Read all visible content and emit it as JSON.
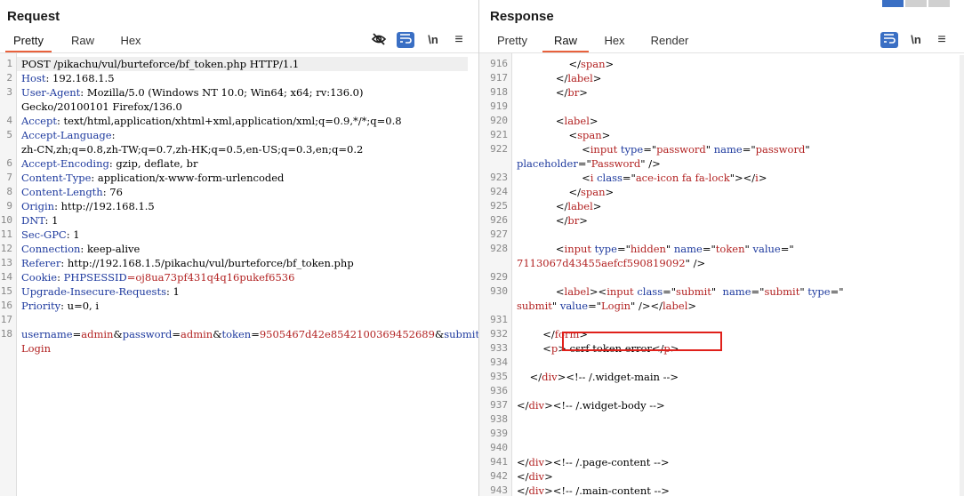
{
  "request": {
    "title": "Request",
    "tabs": [
      "Pretty",
      "Raw",
      "Hex"
    ],
    "active_tab": "Pretty",
    "toolbar": [
      "eye-slash-icon",
      "wrap-icon",
      "\\n",
      "menu-icon"
    ],
    "lines": [
      {
        "n": "1",
        "parts": [
          {
            "t": "POST /pikachu/vul/burteforce/bf_token.php HTTP/1.1",
            "c": ""
          }
        ]
      },
      {
        "n": "2",
        "parts": [
          {
            "t": "Host",
            "c": "hdr"
          },
          {
            "t": ": 192.168.1.5",
            "c": ""
          }
        ]
      },
      {
        "n": "3",
        "parts": [
          {
            "t": "User-Agent",
            "c": "hdr"
          },
          {
            "t": ": Mozilla/5.0 (Windows NT 10.0; Win64; x64; rv:136.0)",
            "c": ""
          }
        ]
      },
      {
        "n": "",
        "parts": [
          {
            "t": "Gecko/20100101 Firefox/136.0",
            "c": ""
          }
        ]
      },
      {
        "n": "4",
        "parts": [
          {
            "t": "Accept",
            "c": "hdr"
          },
          {
            "t": ": text/html,application/xhtml+xml,application/xml;q=0.9,*/*;q=0.8",
            "c": ""
          }
        ]
      },
      {
        "n": "5",
        "parts": [
          {
            "t": "Accept-Language",
            "c": "hdr"
          },
          {
            "t": ":",
            "c": ""
          }
        ]
      },
      {
        "n": "",
        "parts": [
          {
            "t": "zh-CN,zh;q=0.8,zh-TW;q=0.7,zh-HK;q=0.5,en-US;q=0.3,en;q=0.2",
            "c": ""
          }
        ]
      },
      {
        "n": "6",
        "parts": [
          {
            "t": "Accept-Encoding",
            "c": "hdr"
          },
          {
            "t": ": gzip, deflate, br",
            "c": ""
          }
        ]
      },
      {
        "n": "7",
        "parts": [
          {
            "t": "Content-Type",
            "c": "hdr"
          },
          {
            "t": ": application/x-www-form-urlencoded",
            "c": ""
          }
        ]
      },
      {
        "n": "8",
        "parts": [
          {
            "t": "Content-Length",
            "c": "hdr"
          },
          {
            "t": ": 76",
            "c": ""
          }
        ]
      },
      {
        "n": "9",
        "parts": [
          {
            "t": "Origin",
            "c": "hdr"
          },
          {
            "t": ": http://192.168.1.5",
            "c": ""
          }
        ]
      },
      {
        "n": "10",
        "parts": [
          {
            "t": "DNT",
            "c": "hdr"
          },
          {
            "t": ": 1",
            "c": ""
          }
        ]
      },
      {
        "n": "11",
        "parts": [
          {
            "t": "Sec-GPC",
            "c": "hdr"
          },
          {
            "t": ": 1",
            "c": ""
          }
        ]
      },
      {
        "n": "12",
        "parts": [
          {
            "t": "Connection",
            "c": "hdr"
          },
          {
            "t": ": keep-alive",
            "c": ""
          }
        ]
      },
      {
        "n": "13",
        "parts": [
          {
            "t": "Referer",
            "c": "hdr"
          },
          {
            "t": ": http://192.168.1.5/pikachu/vul/burteforce/bf_token.php",
            "c": ""
          }
        ]
      },
      {
        "n": "14",
        "parts": [
          {
            "t": "Cookie",
            "c": "hdr"
          },
          {
            "t": ": ",
            "c": ""
          },
          {
            "t": "PHPSESSID",
            "c": "hdr"
          },
          {
            "t": "=oj8ua73pf431q4q16pukef6536",
            "c": "red"
          }
        ]
      },
      {
        "n": "15",
        "parts": [
          {
            "t": "Upgrade-Insecure-Requests",
            "c": "hdr"
          },
          {
            "t": ": 1",
            "c": ""
          }
        ]
      },
      {
        "n": "16",
        "parts": [
          {
            "t": "Priority",
            "c": "hdr"
          },
          {
            "t": ": u=0, i",
            "c": ""
          }
        ]
      },
      {
        "n": "17",
        "parts": []
      },
      {
        "n": "18",
        "parts": [
          {
            "t": "username",
            "c": "hdr"
          },
          {
            "t": "=",
            "c": ""
          },
          {
            "t": "admin",
            "c": "red"
          },
          {
            "t": "&",
            "c": ""
          },
          {
            "t": "password",
            "c": "hdr"
          },
          {
            "t": "=",
            "c": ""
          },
          {
            "t": "admin",
            "c": "red"
          },
          {
            "t": "&",
            "c": ""
          },
          {
            "t": "token",
            "c": "hdr"
          },
          {
            "t": "=",
            "c": ""
          },
          {
            "t": "9505467d42e8542100369452689",
            "c": "red"
          },
          {
            "t": "&",
            "c": ""
          },
          {
            "t": "submit",
            "c": "hdr"
          },
          {
            "t": "=",
            "c": ""
          }
        ]
      },
      {
        "n": "",
        "parts": [
          {
            "t": "Login",
            "c": "red"
          }
        ]
      }
    ]
  },
  "response": {
    "title": "Response",
    "tabs": [
      "Pretty",
      "Raw",
      "Hex",
      "Render"
    ],
    "active_tab": "Raw",
    "toolbar": [
      "wrap-icon",
      "\\n",
      "menu-icon"
    ],
    "lines": [
      {
        "n": "916",
        "parts": [
          {
            "t": "                </",
            "c": ""
          },
          {
            "t": "span",
            "c": "tag"
          },
          {
            "t": ">",
            "c": ""
          }
        ]
      },
      {
        "n": "917",
        "parts": [
          {
            "t": "            </",
            "c": ""
          },
          {
            "t": "label",
            "c": "tag"
          },
          {
            "t": ">",
            "c": ""
          }
        ]
      },
      {
        "n": "918",
        "parts": [
          {
            "t": "            </",
            "c": ""
          },
          {
            "t": "br",
            "c": "tag"
          },
          {
            "t": ">",
            "c": ""
          }
        ]
      },
      {
        "n": "919",
        "parts": []
      },
      {
        "n": "920",
        "parts": [
          {
            "t": "            <",
            "c": ""
          },
          {
            "t": "label",
            "c": "tag"
          },
          {
            "t": ">",
            "c": ""
          }
        ]
      },
      {
        "n": "921",
        "parts": [
          {
            "t": "                <",
            "c": ""
          },
          {
            "t": "span",
            "c": "tag"
          },
          {
            "t": ">",
            "c": ""
          }
        ]
      },
      {
        "n": "922",
        "parts": [
          {
            "t": "                    <",
            "c": ""
          },
          {
            "t": "input",
            "c": "tag"
          },
          {
            "t": " ",
            "c": ""
          },
          {
            "t": "type",
            "c": "attr"
          },
          {
            "t": "=\"",
            "c": ""
          },
          {
            "t": "password",
            "c": "val"
          },
          {
            "t": "\" ",
            "c": ""
          },
          {
            "t": "name",
            "c": "attr"
          },
          {
            "t": "=\"",
            "c": ""
          },
          {
            "t": "password",
            "c": "val"
          },
          {
            "t": "\"",
            "c": ""
          }
        ]
      },
      {
        "n": "",
        "parts": [
          {
            "t": "placeholder",
            "c": "attr"
          },
          {
            "t": "=\"",
            "c": ""
          },
          {
            "t": "Password",
            "c": "val"
          },
          {
            "t": "\" />",
            "c": ""
          }
        ]
      },
      {
        "n": "923",
        "parts": [
          {
            "t": "                    <",
            "c": ""
          },
          {
            "t": "i",
            "c": "tag"
          },
          {
            "t": " ",
            "c": ""
          },
          {
            "t": "class",
            "c": "attr"
          },
          {
            "t": "=\"",
            "c": ""
          },
          {
            "t": "ace-icon fa fa-lock",
            "c": "val"
          },
          {
            "t": "\"></",
            "c": ""
          },
          {
            "t": "i",
            "c": "tag"
          },
          {
            "t": ">",
            "c": ""
          }
        ]
      },
      {
        "n": "924",
        "parts": [
          {
            "t": "                </",
            "c": ""
          },
          {
            "t": "span",
            "c": "tag"
          },
          {
            "t": ">",
            "c": ""
          }
        ]
      },
      {
        "n": "925",
        "parts": [
          {
            "t": "            </",
            "c": ""
          },
          {
            "t": "label",
            "c": "tag"
          },
          {
            "t": ">",
            "c": ""
          }
        ]
      },
      {
        "n": "926",
        "parts": [
          {
            "t": "            </",
            "c": ""
          },
          {
            "t": "br",
            "c": "tag"
          },
          {
            "t": ">",
            "c": ""
          }
        ]
      },
      {
        "n": "927",
        "parts": []
      },
      {
        "n": "928",
        "parts": [
          {
            "t": "            <",
            "c": ""
          },
          {
            "t": "input",
            "c": "tag"
          },
          {
            "t": " ",
            "c": ""
          },
          {
            "t": "type",
            "c": "attr"
          },
          {
            "t": "=\"",
            "c": ""
          },
          {
            "t": "hidden",
            "c": "val"
          },
          {
            "t": "\" ",
            "c": ""
          },
          {
            "t": "name",
            "c": "attr"
          },
          {
            "t": "=\"",
            "c": ""
          },
          {
            "t": "token",
            "c": "val"
          },
          {
            "t": "\" ",
            "c": ""
          },
          {
            "t": "value",
            "c": "attr"
          },
          {
            "t": "=\"",
            "c": ""
          }
        ]
      },
      {
        "n": "",
        "parts": [
          {
            "t": "7113067d43455aefcf590819092",
            "c": "val"
          },
          {
            "t": "\" />",
            "c": ""
          }
        ]
      },
      {
        "n": "929",
        "parts": []
      },
      {
        "n": "930",
        "parts": [
          {
            "t": "            <",
            "c": ""
          },
          {
            "t": "label",
            "c": "tag"
          },
          {
            "t": "><",
            "c": ""
          },
          {
            "t": "input",
            "c": "tag"
          },
          {
            "t": " ",
            "c": ""
          },
          {
            "t": "class",
            "c": "attr"
          },
          {
            "t": "=\"",
            "c": ""
          },
          {
            "t": "submit",
            "c": "val"
          },
          {
            "t": "\"  ",
            "c": ""
          },
          {
            "t": "name",
            "c": "attr"
          },
          {
            "t": "=\"",
            "c": ""
          },
          {
            "t": "submit",
            "c": "val"
          },
          {
            "t": "\" ",
            "c": ""
          },
          {
            "t": "type",
            "c": "attr"
          },
          {
            "t": "=\"",
            "c": ""
          }
        ]
      },
      {
        "n": "",
        "parts": [
          {
            "t": "submit",
            "c": "val"
          },
          {
            "t": "\" ",
            "c": ""
          },
          {
            "t": "value",
            "c": "attr"
          },
          {
            "t": "=\"",
            "c": ""
          },
          {
            "t": "Login",
            "c": "val"
          },
          {
            "t": "\" /></",
            "c": ""
          },
          {
            "t": "label",
            "c": "tag"
          },
          {
            "t": ">",
            "c": ""
          }
        ]
      },
      {
        "n": "931",
        "parts": []
      },
      {
        "n": "932",
        "parts": [
          {
            "t": "        </",
            "c": ""
          },
          {
            "t": "form",
            "c": "tag"
          },
          {
            "t": ">",
            "c": ""
          }
        ]
      },
      {
        "n": "933",
        "parts": [
          {
            "t": "        <",
            "c": ""
          },
          {
            "t": "p",
            "c": "tag"
          },
          {
            "t": "> csrf token error</",
            "c": ""
          },
          {
            "t": "p",
            "c": "tag"
          },
          {
            "t": ">",
            "c": ""
          }
        ]
      },
      {
        "n": "934",
        "parts": []
      },
      {
        "n": "935",
        "parts": [
          {
            "t": "    </",
            "c": ""
          },
          {
            "t": "div",
            "c": "tag"
          },
          {
            "t": "><",
            "c": ""
          },
          {
            "t": "!-- /.widget-main -->",
            "c": ""
          }
        ]
      },
      {
        "n": "936",
        "parts": []
      },
      {
        "n": "937",
        "parts": [
          {
            "t": "</",
            "c": ""
          },
          {
            "t": "div",
            "c": "tag"
          },
          {
            "t": "><",
            "c": ""
          },
          {
            "t": "!-- /.widget-body -->",
            "c": ""
          }
        ]
      },
      {
        "n": "938",
        "parts": []
      },
      {
        "n": "939",
        "parts": []
      },
      {
        "n": "940",
        "parts": []
      },
      {
        "n": "941",
        "parts": [
          {
            "t": "</",
            "c": ""
          },
          {
            "t": "div",
            "c": "tag"
          },
          {
            "t": "><",
            "c": ""
          },
          {
            "t": "!-- /.page-content -->",
            "c": ""
          }
        ]
      },
      {
        "n": "942",
        "parts": [
          {
            "t": "</",
            "c": ""
          },
          {
            "t": "div",
            "c": "tag"
          },
          {
            "t": ">",
            "c": ""
          }
        ]
      },
      {
        "n": "943",
        "parts": [
          {
            "t": "</",
            "c": ""
          },
          {
            "t": "div",
            "c": "tag"
          },
          {
            "t": "><",
            "c": ""
          },
          {
            "t": "!-- /.main-content -->",
            "c": ""
          }
        ]
      }
    ]
  },
  "colors": {
    "accent_tab": "#e8613c",
    "highlight_box": "#e0201a",
    "header_name": "#1e3a9e",
    "value": "#b22222"
  }
}
